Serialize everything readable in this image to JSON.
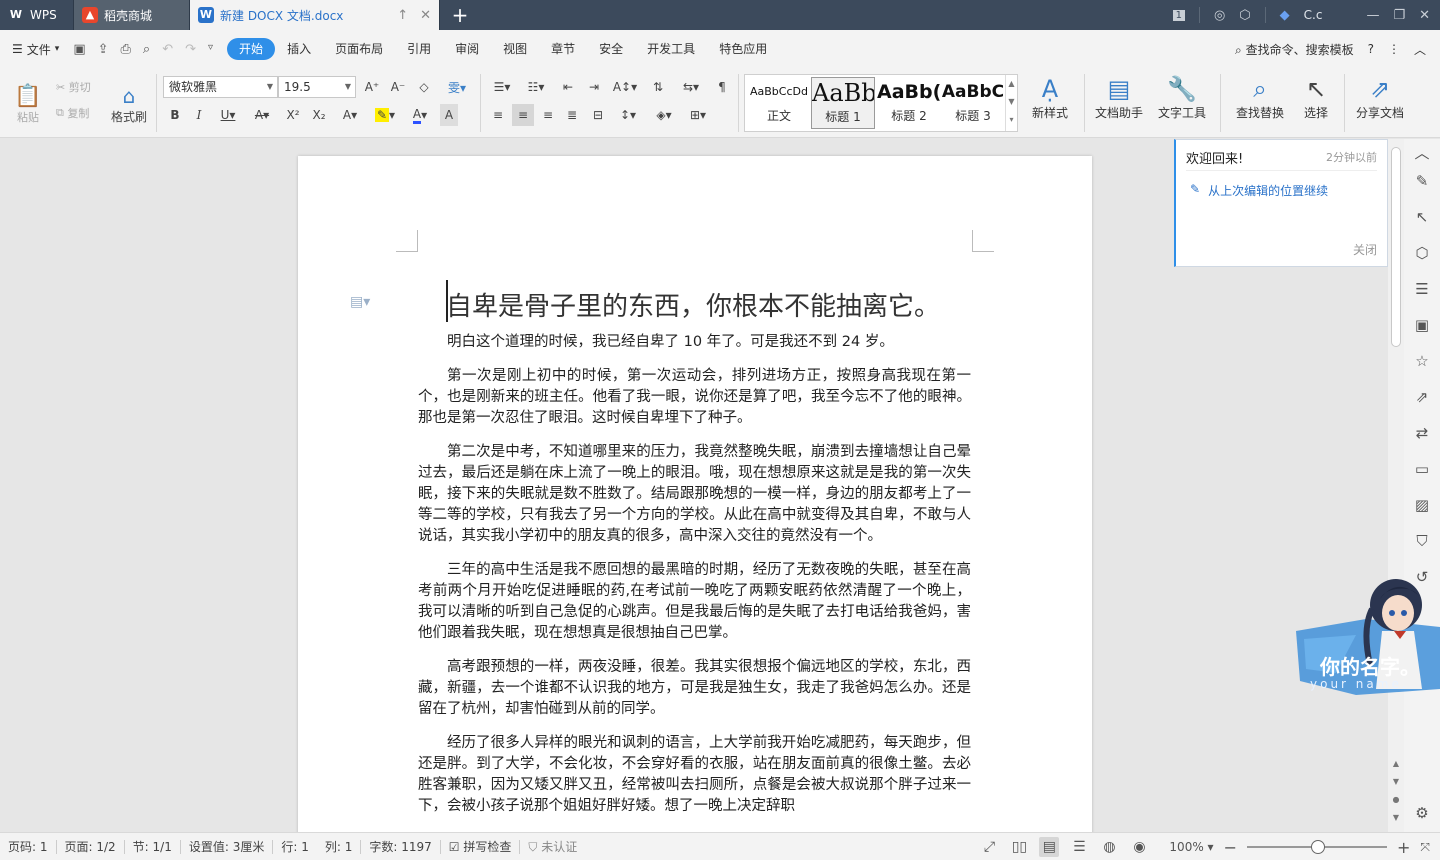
{
  "titlebar": {
    "tabs": [
      {
        "label": "WPS",
        "icon": "wps-logo-icon"
      },
      {
        "label": "稻壳商城",
        "icon": "fire-icon"
      },
      {
        "label": "新建 DOCX 文档.docx",
        "icon": "word-doc-icon"
      }
    ],
    "user": "C.c",
    "page_indicator": "1"
  },
  "menubar": {
    "file": "文件",
    "items": [
      "开始",
      "插入",
      "页面布局",
      "引用",
      "审阅",
      "视图",
      "章节",
      "安全",
      "开发工具",
      "特色应用"
    ],
    "active": "开始",
    "search": "查找命令、搜索模板"
  },
  "ribbon": {
    "paste": "粘贴",
    "cut": "剪切",
    "copy": "复制",
    "format_painter": "格式刷",
    "font_name": "微软雅黑",
    "font_size": "19.5",
    "styles": [
      {
        "sample": "AaBbCcDd",
        "name": "正文"
      },
      {
        "sample": "AaBb",
        "name": "标题 1"
      },
      {
        "sample": "AaBb(",
        "name": "标题 2"
      },
      {
        "sample": "AaBbC",
        "name": "标题 3"
      }
    ],
    "new_style": "新样式",
    "doc_assistant": "文档助手",
    "text_tools": "文字工具",
    "find_replace": "查找替换",
    "select": "选择",
    "share": "分享文档"
  },
  "document": {
    "title": "自卑是骨子里的东西，你根本不能抽离它。",
    "paragraphs": [
      "明白这个道理的时候，我已经自卑了 10 年了。可是我还不到 24 岁。",
      "第一次是刚上初中的时候，第一次运动会，排列进场方正，按照身高我现在第一个，也是刚新来的班主任。他看了我一眼，说你还是算了吧，我至今忘不了他的眼神。那也是第一次忍住了眼泪。这时候自卑埋下了种子。",
      "第二次是中考，不知道哪里来的压力，我竟然整晚失眠，崩溃到去撞墙想让自己晕过去，最后还是躺在床上流了一晚上的眼泪。哦，现在想想原来这就是是我的第一次失眠，接下来的失眠就是数不胜数了。结局跟那晚想的一模一样，身边的朋友都考上了一等二等的学校，只有我去了另一个方向的学校。从此在高中就变得及其自卑，不敢与人说话，其实我小学初中的朋友真的很多，高中深入交往的竟然没有一个。",
      "三年的高中生活是我不愿回想的最黑暗的时期，经历了无数夜晚的失眠，甚至在高考前两个月开始吃促进睡眠的药,在考试前一晚吃了两颗安眠药依然清醒了一个晚上，我可以清晰的听到自己急促的心跳声。但是我最后悔的是失眠了去打电话给我爸妈，害他们跟着我失眠，现在想想真是很想抽自己巴掌。",
      "高考跟预想的一样，两夜没睡，很差。我其实很想报个偏远地区的学校，东北，西藏，新疆，去一个谁都不认识我的地方，可是我是独生女，我走了我爸妈怎么办。还是留在了杭州，却害怕碰到从前的同学。",
      "经历了很多人异样的眼光和讽刺的语言，上大学前我开始吃减肥药，每天跑步，但还是胖。到了大学，不会化妆，不会穿好看的衣服，站在朋友面前真的很像土鳖。去必胜客兼职，因为又矮又胖又丑，经常被叫去扫厕所，点餐是会被大叔说那个胖子过来一下，会被小孩子说那个姐姐好胖好矮。想了一晚上决定辞职"
    ]
  },
  "welcome": {
    "title": "欢迎回来!",
    "time": "2分钟以前",
    "link": "从上次编辑的位置继续",
    "close": "关闭"
  },
  "mascot": {
    "line1": "你的名字。",
    "line2": "your name."
  },
  "statusbar": {
    "page_num": "页码: 1",
    "page_total": "页面: 1/2",
    "section": "节: 1/1",
    "setting": "设置值: 3厘米",
    "row": "行: 1",
    "col": "列: 1",
    "word_count": "字数: 1197",
    "spell_check": "拼写检查",
    "certified": "未认证",
    "zoom": "100%"
  }
}
